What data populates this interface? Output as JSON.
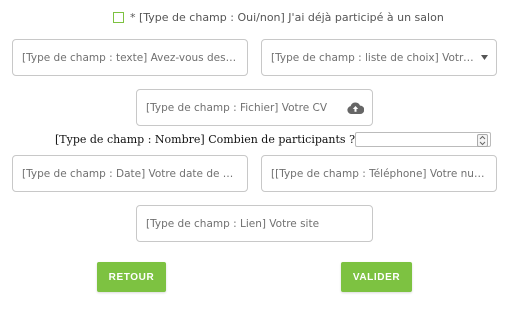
{
  "checkbox": {
    "label": "* [Type de champ : Oui/non] J'ai déjà participé à un salon",
    "checked": false
  },
  "fields": {
    "text": "[Type de champ : texte] Avez-vous des recom...",
    "select": "[Type de champ : liste de choix] Votre secteur ...",
    "file": "[Type de champ : Fichier] Votre CV",
    "number_label": "[Type de champ : Nombre] Combien de participants ?",
    "number_value": "",
    "date": "[Type de champ : Date] Votre date de naissance",
    "phone": "[[Type de champ : Téléphone] Votre numéro de...",
    "link": "[Type de champ : Lien] Votre site"
  },
  "buttons": {
    "back": "RETOUR",
    "submit": "VALIDER"
  },
  "colors": {
    "accent": "#7dc241",
    "border": "#c8c8c8",
    "placeholder": "#707070"
  },
  "icons": {
    "upload": "cloud-upload-icon",
    "dropdown": "dropdown-arrow-icon",
    "spinner": "number-spinner-icon"
  }
}
